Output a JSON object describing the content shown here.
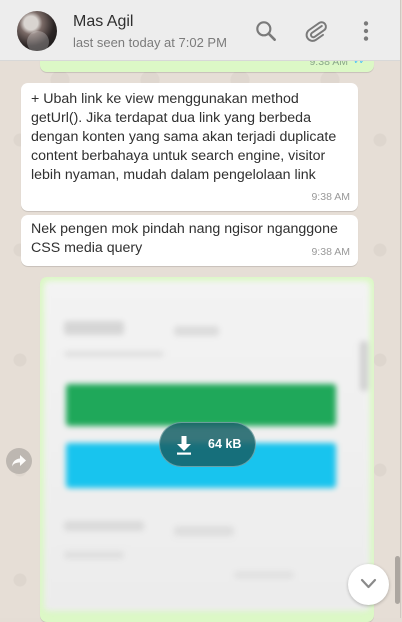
{
  "header": {
    "contact_name": "Mas Agil",
    "status": "last seen today at 7:02 PM"
  },
  "messages": {
    "prev_time": "9:38 AM",
    "msg1": {
      "text": "+ Ubah link ke view menggunakan method\ngetUrl(). Jika terdapat dua link yang berbeda\ndengan konten yang sama akan terjadi duplicate\ncontent berbahaya untuk search engine, visitor\nlebih nyaman, mudah dalam pengelolaan link",
      "time": "9:38 AM"
    },
    "msg2": {
      "text": "Nek pengen mok pindah nang ngisor nganggone\nCSS media query",
      "time": "9:38 AM"
    },
    "image_msg": {
      "download_size": "64 kB"
    }
  },
  "colors": {
    "incoming_bubble": "#ffffff",
    "outgoing_bubble": "#dcf8c6",
    "header_bg": "#ededed",
    "read_ticks": "#4fc3f7"
  }
}
